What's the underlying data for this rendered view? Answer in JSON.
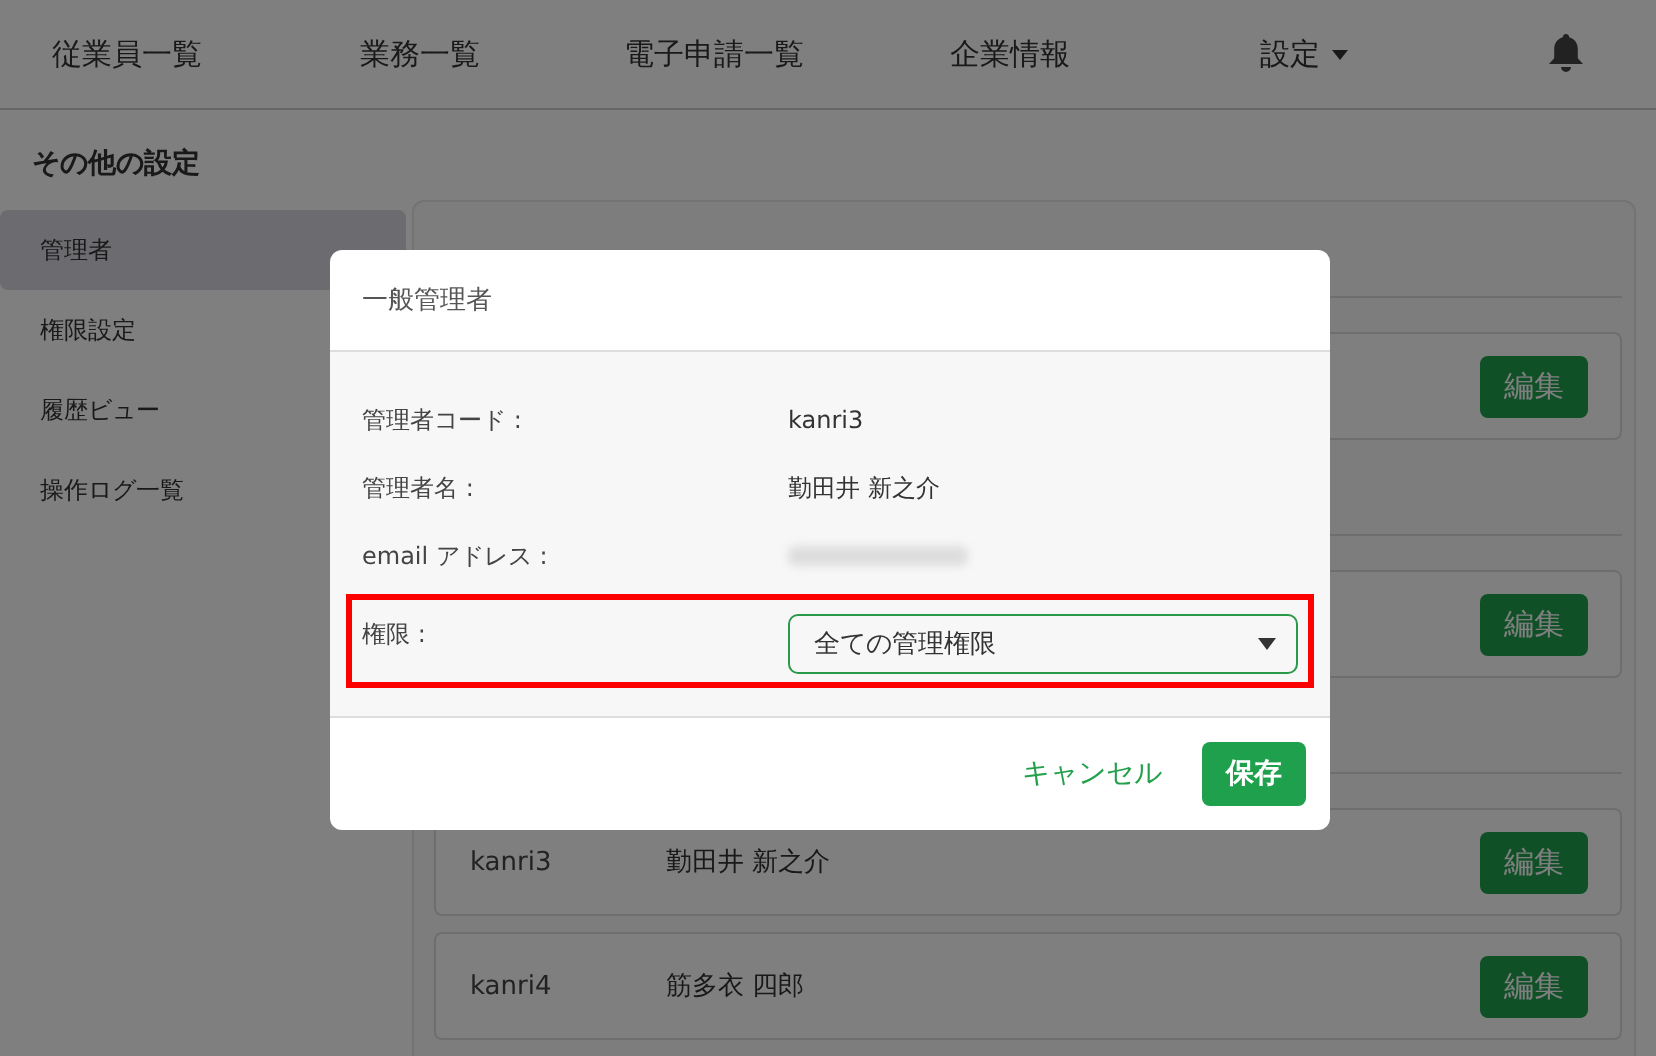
{
  "nav": {
    "items": [
      {
        "label": "従業員一覧",
        "kind": "link"
      },
      {
        "label": "業務一覧",
        "kind": "link"
      },
      {
        "label": "電子申請一覧",
        "kind": "link"
      },
      {
        "label": "企業情報",
        "kind": "link"
      },
      {
        "label": "設定",
        "kind": "dropdown"
      }
    ]
  },
  "sidebar": {
    "title": "その他の設定",
    "items": [
      {
        "label": "管理者",
        "selected": true
      },
      {
        "label": "権限設定",
        "selected": false
      },
      {
        "label": "履歴ビュー",
        "selected": false
      },
      {
        "label": "操作ログ一覧",
        "selected": false
      }
    ]
  },
  "admin_list": {
    "groups": [
      {
        "rows": [
          {
            "button": "編集"
          }
        ]
      },
      {
        "rows": [
          {
            "button": "編集"
          }
        ]
      },
      {
        "rows": [
          {
            "code": "kanri3",
            "name": "勤田井 新之介",
            "button": "編集"
          },
          {
            "code": "kanri4",
            "name": "筋多衣 四郎",
            "button": "編集"
          }
        ]
      }
    ]
  },
  "dialog": {
    "title": "一般管理者",
    "fields": [
      {
        "label": "管理者コード :",
        "kind": "text",
        "value": "kanri3",
        "highlighted": false
      },
      {
        "label": "管理者名 :",
        "kind": "text",
        "value": "勤田井 新之介",
        "highlighted": false
      },
      {
        "label": "email アドレス :",
        "kind": "redacted",
        "highlighted": false
      },
      {
        "label": "権限 :",
        "kind": "select",
        "value": "全ての管理権限",
        "highlighted": true
      }
    ],
    "cancel": "キャンセル",
    "save": "保存"
  }
}
